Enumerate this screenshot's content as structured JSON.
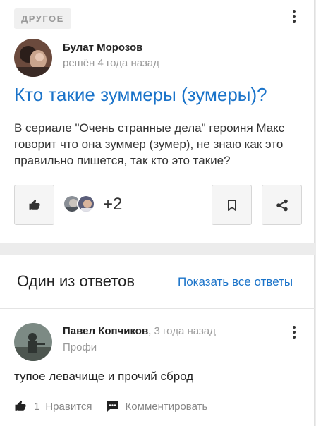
{
  "question": {
    "category": "ДРУГОЕ",
    "author": {
      "name": "Булат Морозов",
      "status": "решён 4 года назад"
    },
    "title": "Кто такие зуммеры (зумеры)?",
    "body": "В сериале \"Очень странные дела\" героиня Макс говорит что она зуммер (зумер), не знаю как это правильно пишется, так кто это такие?",
    "participants_extra": "+2",
    "icons": {
      "like": "thumb-up-icon",
      "bookmark": "bookmark-icon",
      "share": "share-icon",
      "menu": "kebab-menu-icon"
    }
  },
  "answers": {
    "heading": "Один из ответов",
    "show_all": "Показать все ответы",
    "item": {
      "author": "Павел Копчиков",
      "separator": ",",
      "time": "3 года назад",
      "role": "Профи",
      "body": "тупое левачище и прочий сброд",
      "like_count": "1",
      "like_label": "Нравится",
      "comment_label": "Комментировать"
    }
  },
  "colors": {
    "accent": "#1a73c9",
    "muted": "#999999",
    "text": "#222222"
  }
}
